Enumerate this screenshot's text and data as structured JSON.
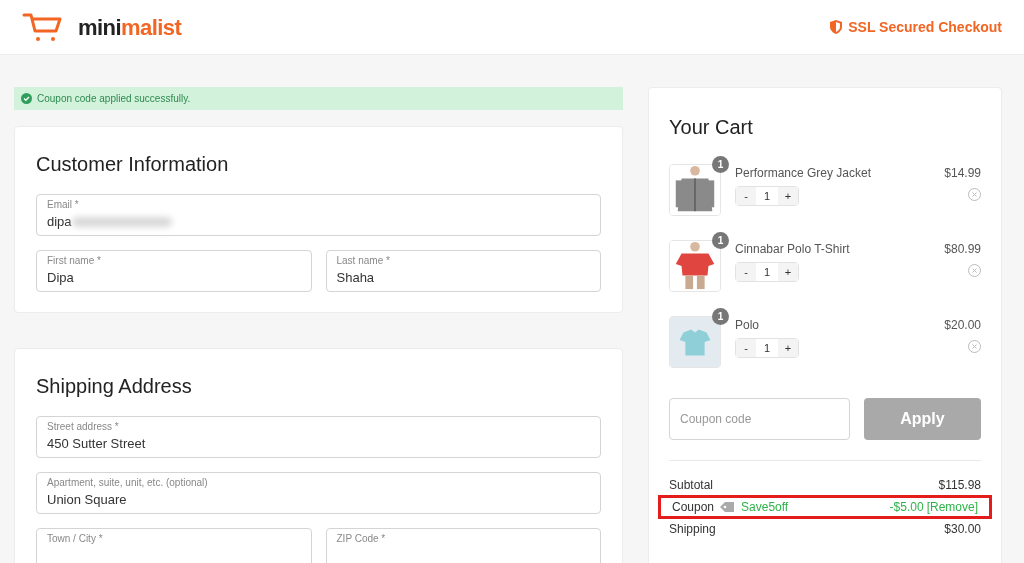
{
  "header": {
    "logo": {
      "dark": "mini",
      "accent": "malist"
    },
    "secure_label": "SSL Secured Checkout"
  },
  "notice": {
    "text": "Coupon code applied successfully."
  },
  "sections": [
    {
      "title": "Customer Information",
      "rows": [
        [
          {
            "label": "Email *",
            "value": "dipa",
            "blurred": true
          }
        ],
        [
          {
            "label": "First name *",
            "value": "Dipa"
          },
          {
            "label": "Last name *",
            "value": "Shaha"
          }
        ]
      ]
    },
    {
      "title": "Shipping Address",
      "rows": [
        [
          {
            "label": "Street address *",
            "value": "450 Sutter Street"
          }
        ],
        [
          {
            "label": "Apartment, suite, unit, etc. (optional)",
            "value": "Union Square"
          }
        ],
        [
          {
            "label": "Town / City *"
          },
          {
            "label": "ZIP Code *"
          }
        ]
      ]
    }
  ],
  "cart": {
    "title": "Your Cart",
    "items": [
      {
        "name": "Performance Grey Jacket",
        "price": "$14.99",
        "badge": "1",
        "quantity": "1",
        "minus": "-",
        "plus": "+",
        "kind": "jacket"
      },
      {
        "name": "Cinnabar Polo T-Shirt",
        "price": "$80.99",
        "badge": "1",
        "quantity": "1",
        "minus": "-",
        "plus": "+",
        "kind": "shirt"
      },
      {
        "name": "Polo",
        "price": "$20.00",
        "badge": "1",
        "quantity": "1",
        "minus": "-",
        "plus": "+",
        "kind": "folded"
      }
    ],
    "coupon_placeholder": "Coupon code",
    "apply_label": "Apply",
    "totals": [
      {
        "kind": "plain",
        "label": "Subtotal",
        "value": "$115.98"
      },
      {
        "kind": "coupon",
        "label": "Coupon",
        "code": "Save5off",
        "value": "-$5.00",
        "action": "[Remove]",
        "highlighted": true
      },
      {
        "kind": "plain",
        "label": "Shipping",
        "value": "$30.00"
      }
    ]
  }
}
